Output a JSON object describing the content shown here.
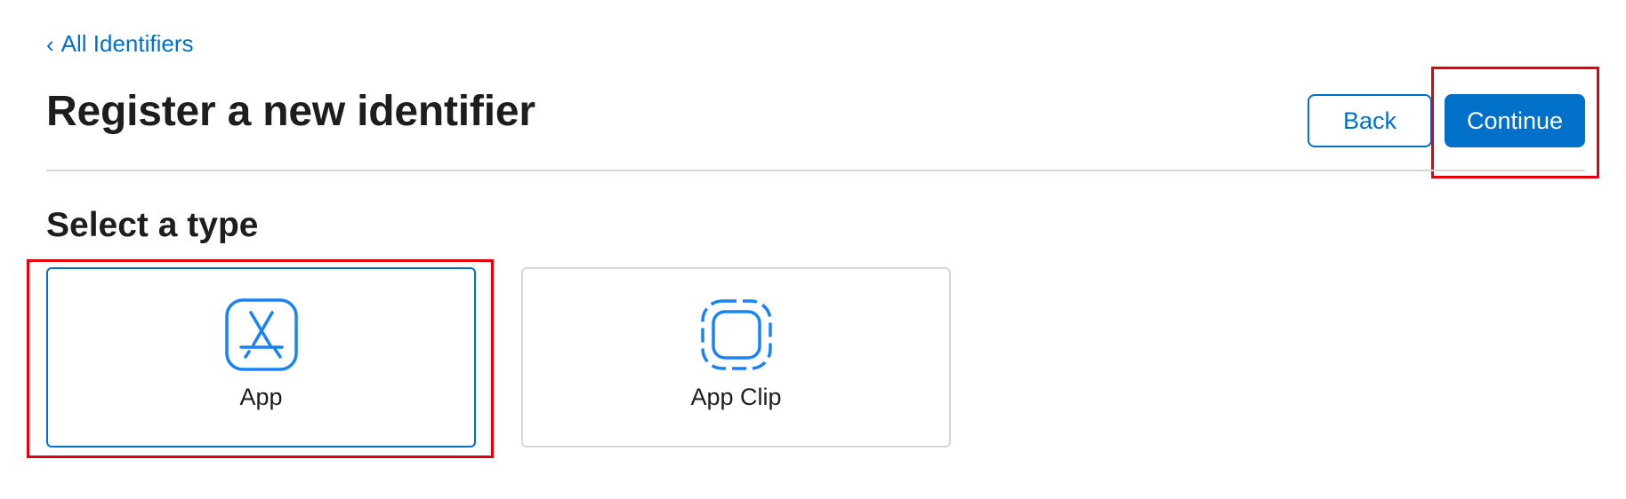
{
  "nav": {
    "back_link_chevron": "‹",
    "back_link_label": "All Identifiers"
  },
  "header": {
    "title": "Register a new identifier",
    "back_button": "Back",
    "continue_button": "Continue"
  },
  "section": {
    "title": "Select a type"
  },
  "types": [
    {
      "label": "App",
      "icon": "app-store-icon",
      "selected": true
    },
    {
      "label": "App Clip",
      "icon": "app-clip-icon",
      "selected": false
    }
  ],
  "colors": {
    "accent": "#0070c9",
    "highlight": "#e3000f",
    "icon": "#1a82f7",
    "border": "#d6d6d6"
  }
}
